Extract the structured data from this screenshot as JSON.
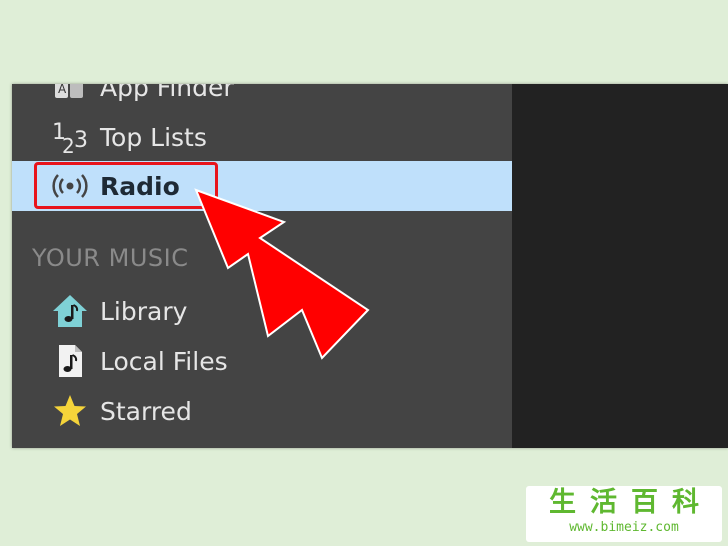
{
  "sidebar": {
    "items": [
      {
        "label": "App Finder",
        "icon": "app-finder-icon"
      },
      {
        "label": "Top Lists",
        "icon": "top-lists-icon"
      },
      {
        "label": "Radio",
        "icon": "radio-icon"
      }
    ],
    "section_header": "YOUR MUSIC",
    "music_items": [
      {
        "label": "Library",
        "icon": "library-icon"
      },
      {
        "label": "Local Files",
        "icon": "local-files-icon"
      },
      {
        "label": "Starred",
        "icon": "star-icon"
      }
    ]
  },
  "colors": {
    "page_bg": "#dfeed7",
    "sidebar_bg": "#444444",
    "right_pane_bg": "#222222",
    "selected_bg": "#bfe0fb",
    "highlight": "#e8141c",
    "star": "#f5d43a",
    "library_icon": "#7fd1d6",
    "watermark_green": "#5fb830"
  },
  "watermark": {
    "title": "生活百科",
    "url": "www.bimeiz.com"
  }
}
